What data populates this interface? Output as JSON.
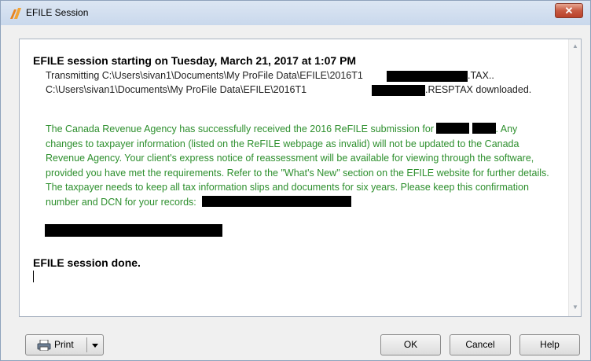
{
  "window": {
    "title": "EFILE Session",
    "close_glyph": "✕",
    "icon": "profile-app-icon"
  },
  "log": {
    "session_start": "EFILE session starting on Tuesday, March 21, 2017 at 1:07 PM",
    "transmit_prefix": "Transmitting C:\\Users\\sivan1\\Documents\\My ProFile Data\\EFILE\\2016T1",
    "transmit_suffix": ".TAX..",
    "download_prefix": "C:\\Users\\sivan1\\Documents\\My ProFile Data\\EFILE\\2016T1",
    "download_suffix": ".RESPTAX downloaded.",
    "message_part1": "The Canada Revenue Agency has successfully received the 2016 ReFILE submission for",
    "message_part2": ". Any changes to taxpayer information (listed on the ReFILE webpage as invalid) will not be updated to the Canada Revenue Agency. Your client's express notice of reassessment will be available for viewing through the software, provided you have met the requirements. Refer to the \"What's New\" section on the EFILE website for further details. The taxpayer needs to keep all tax information slips and documents for six years. Please keep this confirmation number and DCN for your records:",
    "session_done": "EFILE session done.",
    "message_color": "#2d8f2d"
  },
  "buttons": {
    "print": "Print",
    "ok": "OK",
    "cancel": "Cancel",
    "help": "Help"
  }
}
